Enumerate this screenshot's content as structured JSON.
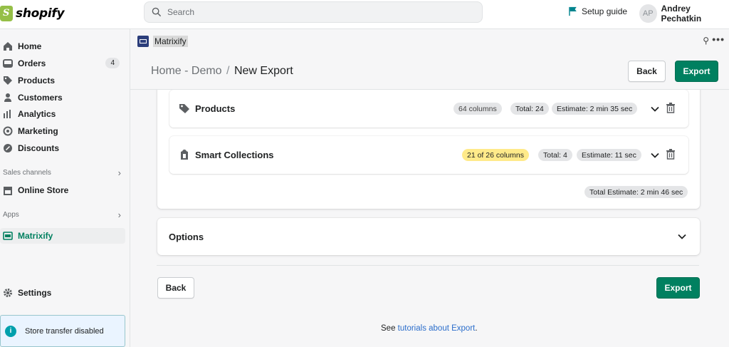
{
  "topbar": {
    "brand": "shopify",
    "search_placeholder": "Search",
    "setup_guide": "Setup guide",
    "user_initials": "AP",
    "user_name": "Andrey Pechatkin"
  },
  "sidebar": {
    "items": [
      {
        "label": "Home",
        "icon": "home-icon"
      },
      {
        "label": "Orders",
        "icon": "orders-icon",
        "badge": "4"
      },
      {
        "label": "Products",
        "icon": "tag-icon"
      },
      {
        "label": "Customers",
        "icon": "person-icon"
      },
      {
        "label": "Analytics",
        "icon": "bar-chart-icon"
      },
      {
        "label": "Marketing",
        "icon": "target-icon"
      },
      {
        "label": "Discounts",
        "icon": "discount-icon"
      }
    ],
    "sales_channels_label": "Sales channels",
    "online_store": "Online Store",
    "apps_label": "Apps",
    "app_item": "Matrixify",
    "settings": "Settings",
    "transfer_notice": "Store transfer disabled"
  },
  "app": {
    "name": "Matrixify"
  },
  "page": {
    "crumb_parent": "Home - Demo",
    "crumb_sep": "/",
    "crumb_current": "New Export",
    "back_label": "Back",
    "export_label": "Export"
  },
  "export_items": [
    {
      "title": "Products",
      "columns": "64 columns",
      "total": "Total: 24",
      "estimate": "Estimate: 2 min 35 sec",
      "columns_highlight": false
    },
    {
      "title": "Smart Collections",
      "columns": "21 of 26 columns",
      "total": "Total: 4",
      "estimate": "Estimate: 11 sec",
      "columns_highlight": true
    }
  ],
  "total_estimate": "Total Estimate: 2 min 46 sec",
  "options_label": "Options",
  "footer": {
    "prefix": "See ",
    "link": "tutorials about Export",
    "suffix": "."
  },
  "colors": {
    "primary_green": "#008060",
    "highlight_yellow": "#ffea8a",
    "link_blue": "#2c6ecb"
  }
}
